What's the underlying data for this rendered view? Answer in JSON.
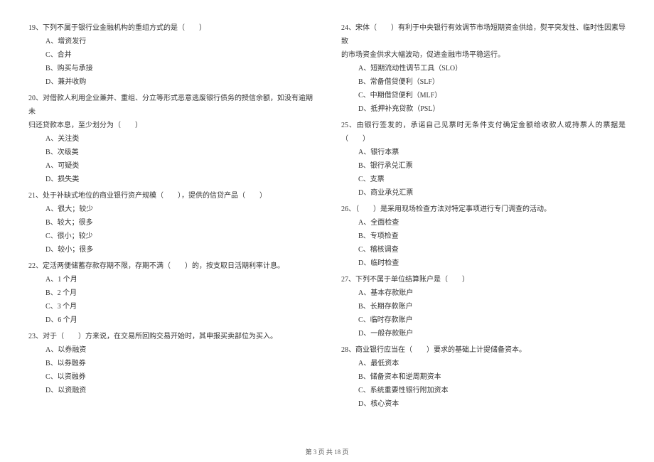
{
  "left": {
    "q19": {
      "text": "19、下列不属于银行业金融机构的重组方式的是（　　）",
      "options": [
        "A、增资发行",
        "C、合并",
        "B、购买与承接",
        "D、兼并收购"
      ]
    },
    "q20": {
      "text": "20、对借款人利用企业兼并、重组、分立等形式恶意逃废银行债务的授信余额，如没有逾期未",
      "cont": "归还贷款本息，至少划分为（　　）",
      "options": [
        "A、关注类",
        "B、次级类",
        "A、可疑类",
        "D、损失类"
      ]
    },
    "q21": {
      "text": "21、处于补缺式地位的商业银行资产规模（　　），提供的信贷产品（　　）",
      "options": [
        "A、很大；较少",
        "B、较大；很多",
        "C、很小；较少",
        "D、较小；很多"
      ]
    },
    "q22": {
      "text": "22、定活两便储蓄存款存期不限，存期不满（　　）的，按支取日活期利率计息。",
      "options": [
        "A、1 个月",
        "B、2 个月",
        "C、3 个月",
        "D、6 个月"
      ]
    },
    "q23": {
      "text": "23、对于（　　）方来说，在交易所回购交易开始时，其申报买卖部位为买入。",
      "options": [
        "A、以券融资",
        "B、以券融券",
        "C、以资融券",
        "D、以资融资"
      ]
    }
  },
  "right": {
    "q24": {
      "text": "24、宋体（　　）有利于中央银行有效调节市场短期资金供给，熨平突发性、临时性因素导致",
      "cont": "的市场资金供求大幅波动，促进金融市场平稳运行。",
      "options": [
        "A、短期流动性调节工具（SLO）",
        "B、常备借贷便利（SLF）",
        "C、中期借贷便利（MLF）",
        "D、抵押补充贷款（PSL）"
      ]
    },
    "q25": {
      "text": "25、由银行签发的，承诺自己见票时无条件支付确定金额给收款人或持票人的票据是（　　）",
      "options": [
        "A、银行本票",
        "B、银行承兑汇票",
        "C、支票",
        "D、商业承兑汇票"
      ]
    },
    "q26": {
      "text": "26、（　　）是采用现场检查方法对特定事项进行专门调查的活动。",
      "options": [
        "A、全面检查",
        "B、专项检查",
        "C、稽核调查",
        "D、临时检查"
      ]
    },
    "q27": {
      "text": "27、下列不属于单位结算账户是（　　）",
      "options": [
        "A、基本存款账户",
        "B、长期存款账户",
        "C、临时存款账户",
        "D、一般存款账户"
      ]
    },
    "q28": {
      "text": "28、商业银行应当在（　　）要求的基础上计提储备资本。",
      "options": [
        "A、最低资本",
        "B、储备资本和逆周期资本",
        "C、系统重要性银行附加资本",
        "D、核心资本"
      ]
    }
  },
  "footer": "第 3 页 共 18 页"
}
